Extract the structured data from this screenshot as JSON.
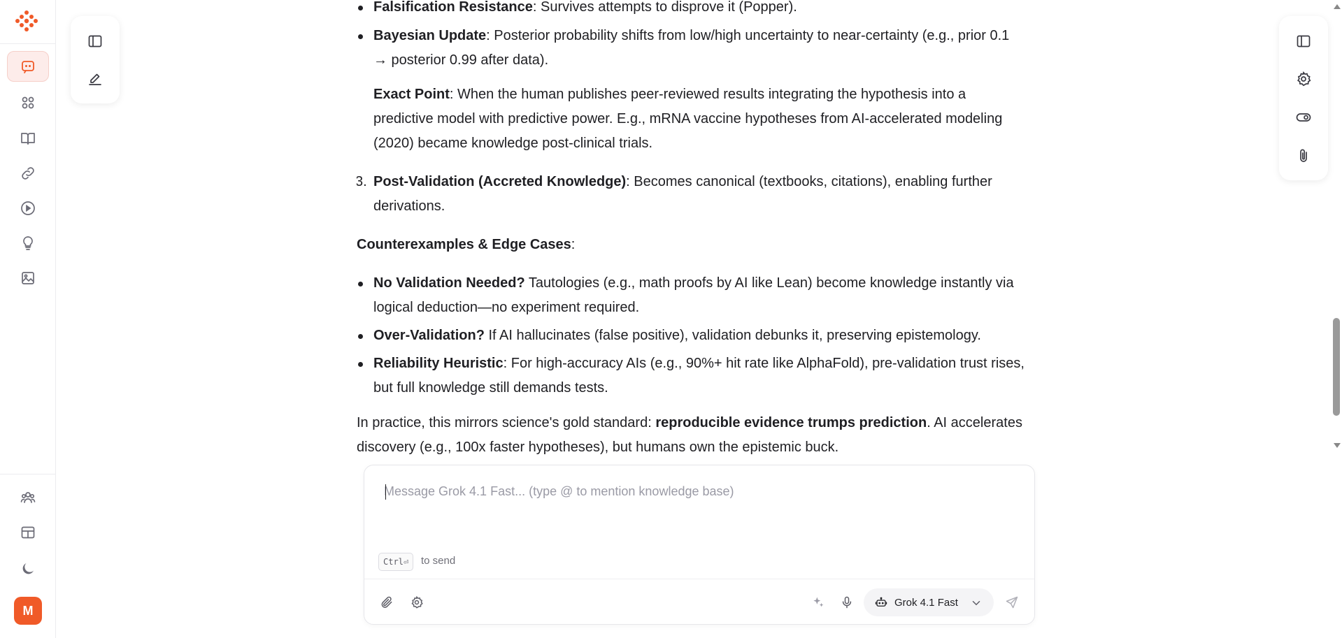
{
  "rail": {
    "avatar_letter": "M",
    "accent_color": "#f05a28"
  },
  "content": {
    "bullets_top": [
      {
        "bold": "Falsification Resistance",
        "text": ": Survives attempts to disprove it (Popper)."
      },
      {
        "bold": "Bayesian Update",
        "text": ": Posterior probability shifts from low/high uncertainty to near-certainty (e.g., prior 0.1",
        "text2": "→ posterior 0.99 after data)."
      }
    ],
    "exact_point": {
      "bold": "Exact Point",
      "line1": ": When the human publishes peer-reviewed results integrating the hypothesis into a",
      "line2": "predictive model with predictive power. E.g., mRNA vaccine hypotheses from AI-accelerated modeling",
      "line3": "(2020) became knowledge post-clinical trials."
    },
    "item3": {
      "num": "3.",
      "bold": "Post-Validation (Accreted Knowledge)",
      "line1": ": Becomes canonical (textbooks, citations), enabling further",
      "line2": "derivations."
    },
    "counter_heading": {
      "bold": "Counterexamples & Edge Cases",
      "tail": ":"
    },
    "counter_bullets": [
      {
        "bold": "No Validation Needed?",
        "line1": " Tautologies (e.g., math proofs by AI like Lean) become knowledge instantly via",
        "line2": "logical deduction—no experiment required."
      },
      {
        "bold": "Over-Validation?",
        "line1": " If AI hallucinates (false positive), validation debunks it, preserving epistemology."
      },
      {
        "bold": "Reliability Heuristic",
        "line1": ": For high-accuracy AIs (e.g., 90%+ hit rate like AlphaFold), pre-validation trust rises,",
        "line2": "but full knowledge still demands tests."
      }
    ],
    "closing": {
      "pre": "In practice, this mirrors science's gold standard: ",
      "bold": "reproducible evidence trumps prediction",
      "post": ". AI accelerates",
      "line2": "discovery (e.g., 100x faster hypotheses), but humans own the epistemic buck."
    }
  },
  "composer": {
    "placeholder": "Message Grok 4.1 Fast... (type @ to mention knowledge base)",
    "value": "",
    "kbd": "Ctrl⏎",
    "send_hint": "to send",
    "model_name": "Grok 4.1 Fast"
  }
}
